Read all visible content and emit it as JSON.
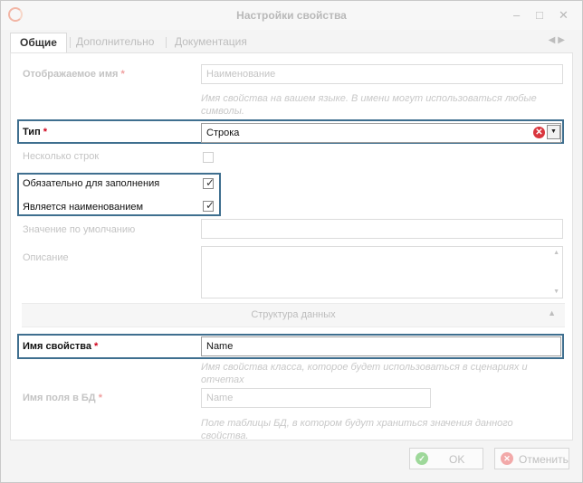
{
  "window": {
    "title": "Настройки свойства"
  },
  "titlebar_buttons": [
    {
      "name": "minimize-button",
      "glyph": "–"
    },
    {
      "name": "maximize-button",
      "glyph": "□"
    },
    {
      "name": "close-button",
      "glyph": "✕"
    }
  ],
  "tabs": [
    {
      "label": "Общие",
      "active": true
    },
    {
      "label": "Дополнительно",
      "active": false
    },
    {
      "label": "Документация",
      "active": false
    }
  ],
  "tab_scroll": {
    "left": "◀",
    "right": "▶"
  },
  "form": {
    "display_name": {
      "label": "Отображаемое имя",
      "required_mark": "*",
      "placeholder": "Наименование",
      "hint": "Имя свойства на вашем языке. В имени могут использоваться любые символы."
    },
    "type": {
      "label": "Тип",
      "required_mark": "*",
      "value": "Строка",
      "clear_glyph": "✕",
      "dropdown_glyph": "▼"
    },
    "multiline": {
      "label": "Несколько строк",
      "checked": false
    },
    "required_field": {
      "label": "Обязательно для заполнения",
      "checked": true
    },
    "is_name": {
      "label": "Является наименованием",
      "checked": true
    },
    "check_glyph": "✓",
    "default_value": {
      "label": "Значение по умолчанию"
    },
    "description": {
      "label": "Описание",
      "scroll_up": "▲",
      "scroll_down": "▼"
    },
    "section": {
      "title": "Структура данных",
      "collapse_glyph": "▲"
    },
    "property_name": {
      "label": "Имя свойства",
      "required_mark": "*",
      "value": "Name",
      "hint": "Имя свойства класса, которое будет использоваться в сценариях и отчетах"
    },
    "db_field_name": {
      "label": "Имя поля в БД",
      "required_mark": "*",
      "placeholder": "Name",
      "hint": "Поле таблицы БД, в котором будут храниться значения данного свойства."
    }
  },
  "footer": {
    "ok_label": "OK",
    "ok_glyph": "✓",
    "cancel_label": "Отменить",
    "cancel_glyph": "✕"
  },
  "colors": {
    "highlight": "#3f6f8f",
    "required": "#d0021b",
    "ok": "#9ed89a",
    "cancel": "#f2a9a9"
  }
}
